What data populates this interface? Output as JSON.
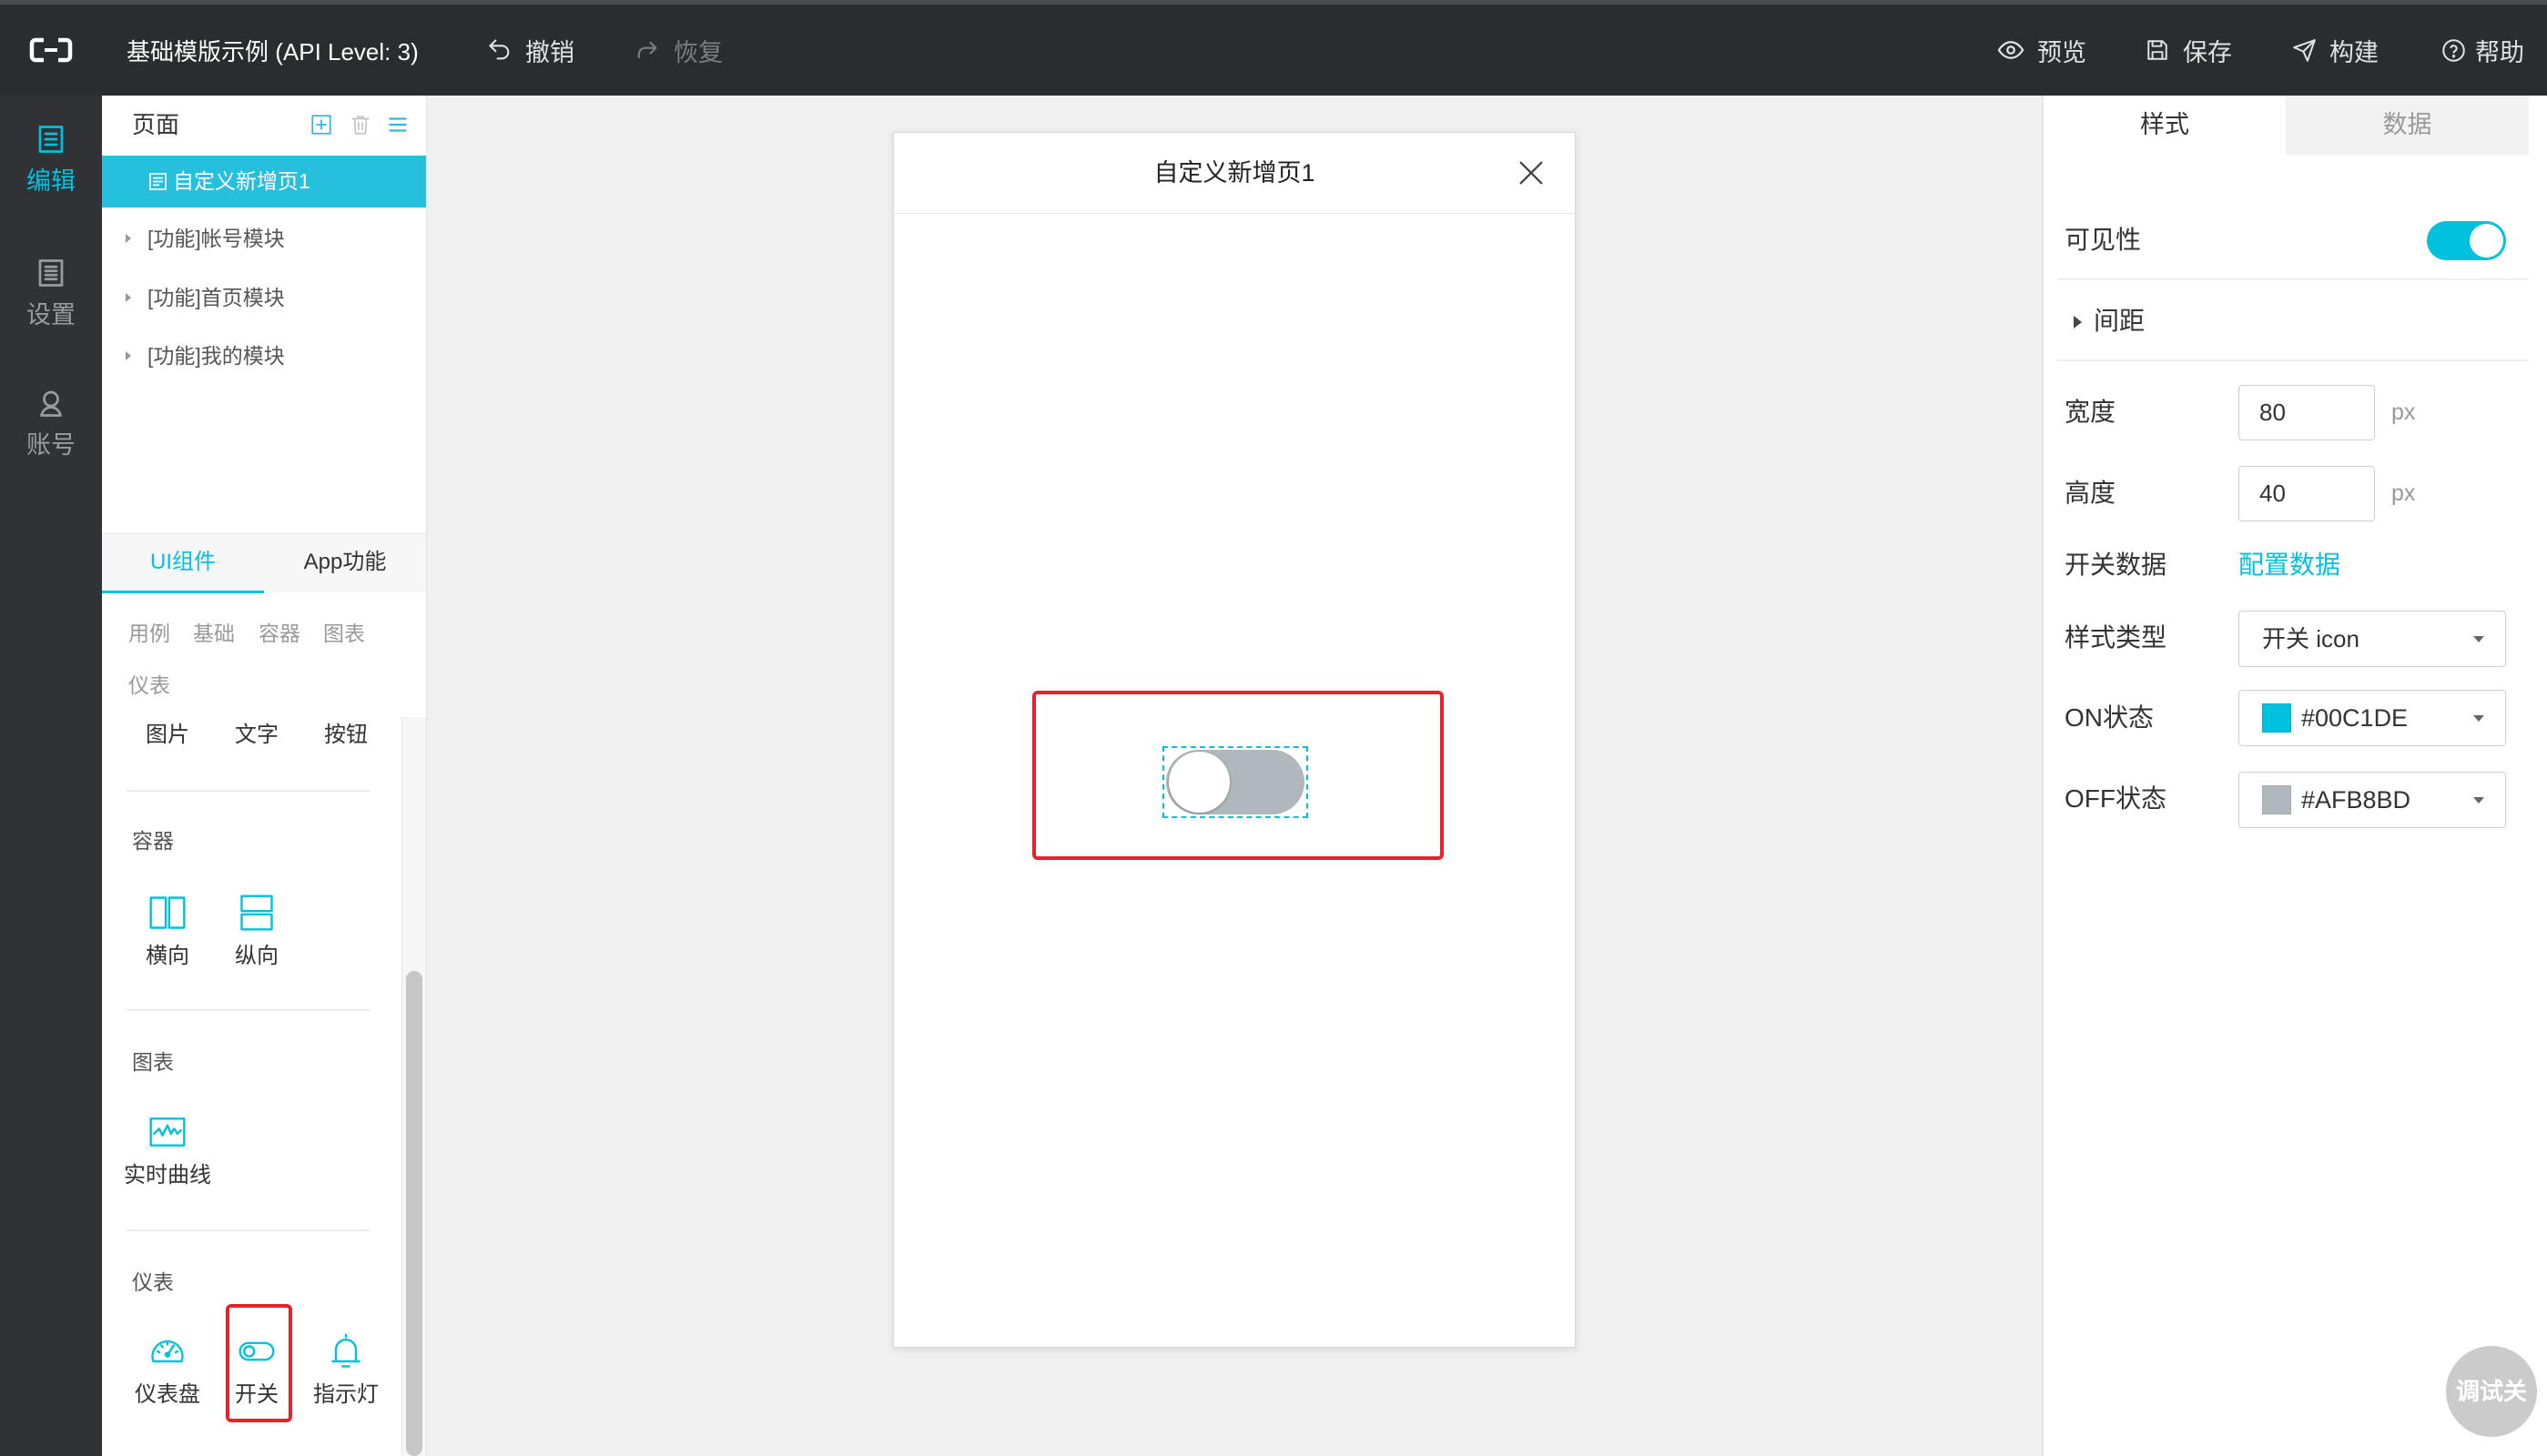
{
  "theme": {
    "accent_color": "#00C1DE"
  },
  "app": {
    "title": "基础模版示例 (API Level: 3)",
    "undo_label": "撤销",
    "redo_label": "恢复",
    "preview_label": "预览",
    "save_label": "保存",
    "build_label": "构建",
    "help_label": "帮助"
  },
  "sidebar": {
    "items": [
      {
        "label": "编辑",
        "icon": "edit-icon",
        "active": true
      },
      {
        "label": "设置",
        "icon": "settings-icon",
        "active": false
      },
      {
        "label": "账号",
        "icon": "account-icon",
        "active": false
      }
    ]
  },
  "pages_panel": {
    "title": "页面",
    "pages": [
      {
        "label": "自定义新增页1",
        "active": true
      },
      {
        "label": "[功能]帐号模块",
        "active": false
      },
      {
        "label": "[功能]首页模块",
        "active": false
      },
      {
        "label": "[功能]我的模块",
        "active": false
      }
    ]
  },
  "library": {
    "tabs": [
      {
        "label": "UI组件",
        "active": true
      },
      {
        "label": "App功能",
        "active": false
      }
    ],
    "filters": [
      "用例",
      "基础",
      "容器",
      "图表",
      "仪表"
    ],
    "basic_items": [
      "图片",
      "文字",
      "按钮"
    ],
    "sections": [
      {
        "title": "容器",
        "items": [
          {
            "label": "横向",
            "icon": "horizontal-layout-icon"
          },
          {
            "label": "纵向",
            "icon": "vertical-layout-icon"
          }
        ]
      },
      {
        "title": "图表",
        "items": [
          {
            "label": "实时曲线",
            "icon": "realtime-curve-icon"
          }
        ]
      },
      {
        "title": "仪表",
        "items": [
          {
            "label": "仪表盘",
            "icon": "gauge-icon"
          },
          {
            "label": "开关",
            "icon": "switch-icon",
            "highlighted": true
          },
          {
            "label": "指示灯",
            "icon": "indicator-light-icon"
          }
        ]
      }
    ]
  },
  "canvas": {
    "page_title": "自定义新增页1",
    "switch": {
      "on": false,
      "selected": true,
      "highlighted": true
    }
  },
  "properties": {
    "tabs": [
      {
        "label": "样式",
        "active": true
      },
      {
        "label": "数据",
        "active": false
      }
    ],
    "visibility": {
      "label": "可见性",
      "on": true
    },
    "spacing": {
      "label": "间距",
      "expanded": false
    },
    "width": {
      "label": "宽度",
      "value": "80",
      "unit": "px"
    },
    "height": {
      "label": "高度",
      "value": "40",
      "unit": "px"
    },
    "switch_data": {
      "label": "开关数据",
      "link": "配置数据"
    },
    "style_type": {
      "label": "样式类型",
      "value": "开关 icon"
    },
    "on_state": {
      "label": "ON状态",
      "color": "#00C1DE"
    },
    "off_state": {
      "label": "OFF状态",
      "color": "#AFB8BD"
    }
  },
  "debug_button": {
    "label": "调试关"
  }
}
